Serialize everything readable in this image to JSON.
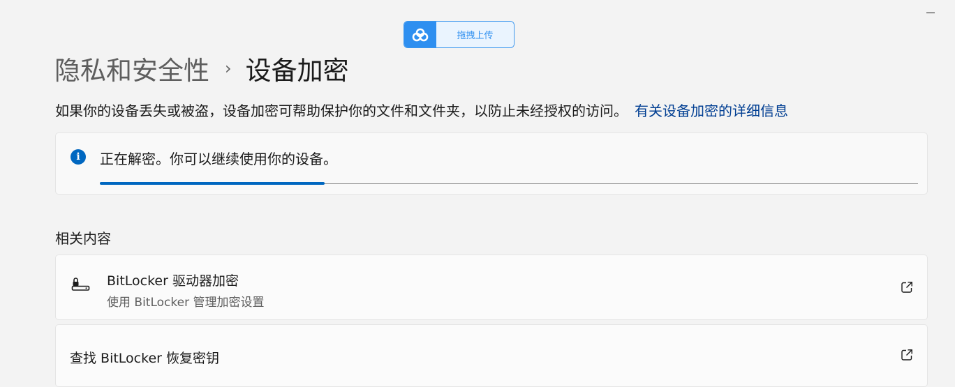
{
  "window": {
    "minimize_icon": "minimize-icon"
  },
  "upload_widget": {
    "label": "拖拽上传",
    "icon": "cloud-logo-icon",
    "accent": "#2e8ff0"
  },
  "breadcrumb": {
    "parent": "隐私和安全性",
    "separator": "›",
    "current": "设备加密"
  },
  "description": {
    "text": "如果你的设备丢失或被盗，设备加密可帮助保护你的文件和文件夹，以防止未经授权的访问。",
    "link": "有关设备加密的详细信息",
    "link_color": "#003e92"
  },
  "status": {
    "icon": "info-icon",
    "info_glyph": "i",
    "text": "正在解密。你可以继续使用你的设备。",
    "progress_percent": 27.5,
    "accent": "#0067c0"
  },
  "related": {
    "title": "相关内容",
    "items": [
      {
        "title": "BitLocker 驱动器加密",
        "subtitle": "使用 BitLocker 管理加密设置",
        "icon": "drive-lock-icon",
        "action_icon": "open-external-icon"
      },
      {
        "title": "查找 BitLocker 恢复密钥",
        "action_icon": "open-external-icon"
      }
    ]
  }
}
